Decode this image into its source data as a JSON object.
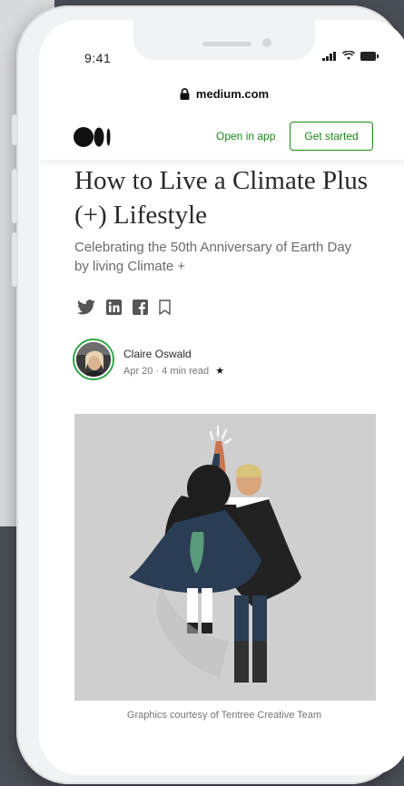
{
  "status_bar": {
    "time": "9:41"
  },
  "browser": {
    "url": "medium.com"
  },
  "header": {
    "open_in_app": "Open in app",
    "get_started": "Get started"
  },
  "article": {
    "title": "How to Live a Climate Plus (+) Lifestyle",
    "subtitle": "Celebrating the 50th Anniversary of Earth Day by living Climate +",
    "author_name": "Claire Oswald",
    "meta": "Apr 20 · 4 min read",
    "caption": "Graphics courtesy of Tentree Creative Team"
  },
  "share_icons": [
    "twitter-icon",
    "linkedin-icon",
    "facebook-icon",
    "bookmark-icon"
  ],
  "colors": {
    "brand_green": "#1a8917",
    "text": "#292929",
    "muted": "#6b6b6b",
    "hero_bg": "#cfcfcf"
  }
}
